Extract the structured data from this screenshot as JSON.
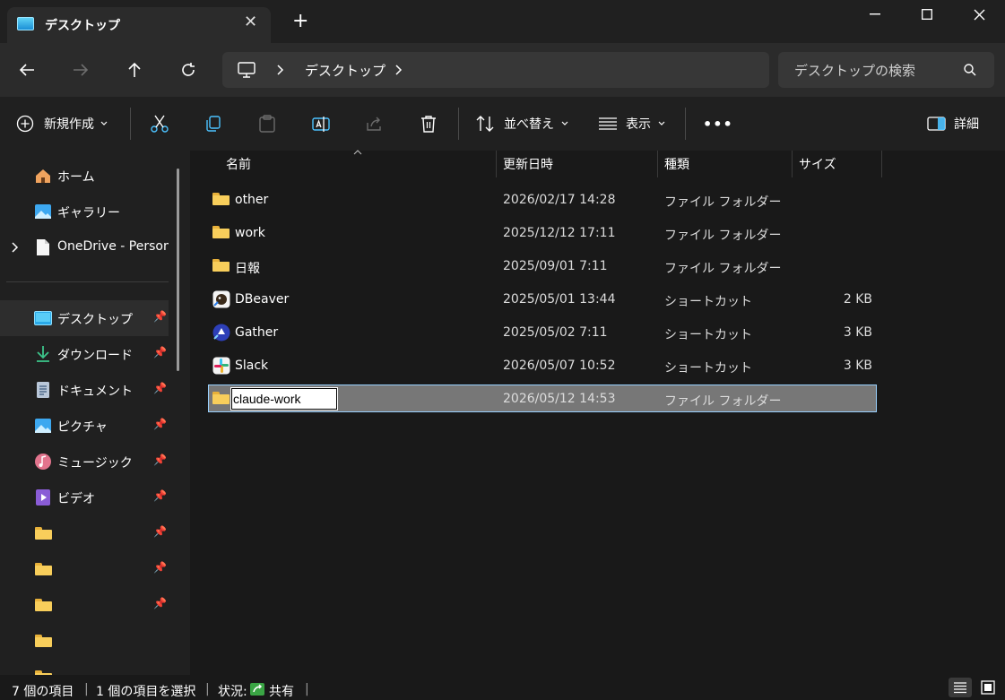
{
  "window": {
    "tab_title": "デスクトップ",
    "tab_close": "✕",
    "new_tab": "+",
    "minimize": "—",
    "maximize": "☐",
    "close": "✕"
  },
  "nav": {
    "breadcrumb": [
      "デスクトップ"
    ],
    "search_placeholder": "デスクトップの検索"
  },
  "toolbar": {
    "new_label": "新規作成",
    "sort_label": "並べ替え",
    "view_label": "表示",
    "more_label": "•••",
    "details_label": "詳細"
  },
  "sidebar": {
    "top_items": [
      {
        "label": "ホーム",
        "icon": "home-icon"
      },
      {
        "label": "ギャラリー",
        "icon": "gallery-icon"
      },
      {
        "label": "OneDrive - Persona",
        "icon": "document-icon"
      }
    ],
    "quick_access": [
      {
        "label": "デスクトップ",
        "icon": "desktop-icon",
        "pinned": true,
        "selected": true
      },
      {
        "label": "ダウンロード",
        "icon": "download-icon",
        "pinned": true
      },
      {
        "label": "ドキュメント",
        "icon": "documents-icon",
        "pinned": true
      },
      {
        "label": "ピクチャ",
        "icon": "pictures-icon",
        "pinned": true
      },
      {
        "label": "ミュージック",
        "icon": "music-icon",
        "pinned": true
      },
      {
        "label": "ビデオ",
        "icon": "video-icon",
        "pinned": true
      },
      {
        "label": "",
        "icon": "folder-icon",
        "pinned": true
      },
      {
        "label": "",
        "icon": "folder-icon",
        "pinned": true
      },
      {
        "label": "",
        "icon": "folder-icon",
        "pinned": true
      },
      {
        "label": "",
        "icon": "folder-icon",
        "pinned": false
      },
      {
        "label": "",
        "icon": "folder-icon",
        "pinned": false
      }
    ]
  },
  "columns": {
    "name": "名前",
    "date": "更新日時",
    "type": "種類",
    "size": "サイズ"
  },
  "files": [
    {
      "name": "other",
      "date": "2026/02/17 14:28",
      "type": "ファイル フォルダー",
      "size": "",
      "icon": "folder-icon"
    },
    {
      "name": "work",
      "date": "2025/12/12 17:11",
      "type": "ファイル フォルダー",
      "size": "",
      "icon": "folder-icon"
    },
    {
      "name": "日報",
      "date": "2025/09/01 7:11",
      "type": "ファイル フォルダー",
      "size": "",
      "icon": "folder-icon"
    },
    {
      "name": "DBeaver",
      "date": "2025/05/01 13:44",
      "type": "ショートカット",
      "size": "2 KB",
      "icon": "dbeaver-icon"
    },
    {
      "name": "Gather",
      "date": "2025/05/02 7:11",
      "type": "ショートカット",
      "size": "3 KB",
      "icon": "gather-icon"
    },
    {
      "name": "Slack",
      "date": "2026/05/07 10:52",
      "type": "ショートカット",
      "size": "3 KB",
      "icon": "slack-icon"
    },
    {
      "name": "claude-work",
      "date": "2026/05/12 14:53",
      "type": "ファイル フォルダー",
      "size": "",
      "icon": "folder-icon",
      "renaming": true
    }
  ],
  "status": {
    "item_count": "7 個の項目",
    "selected": "1 個の項目を選択",
    "state_label": "状況:",
    "shared": "共有"
  },
  "colors": {
    "accent": "#99d1ff",
    "folder": "#f8ce5b",
    "selection": "#777777"
  }
}
